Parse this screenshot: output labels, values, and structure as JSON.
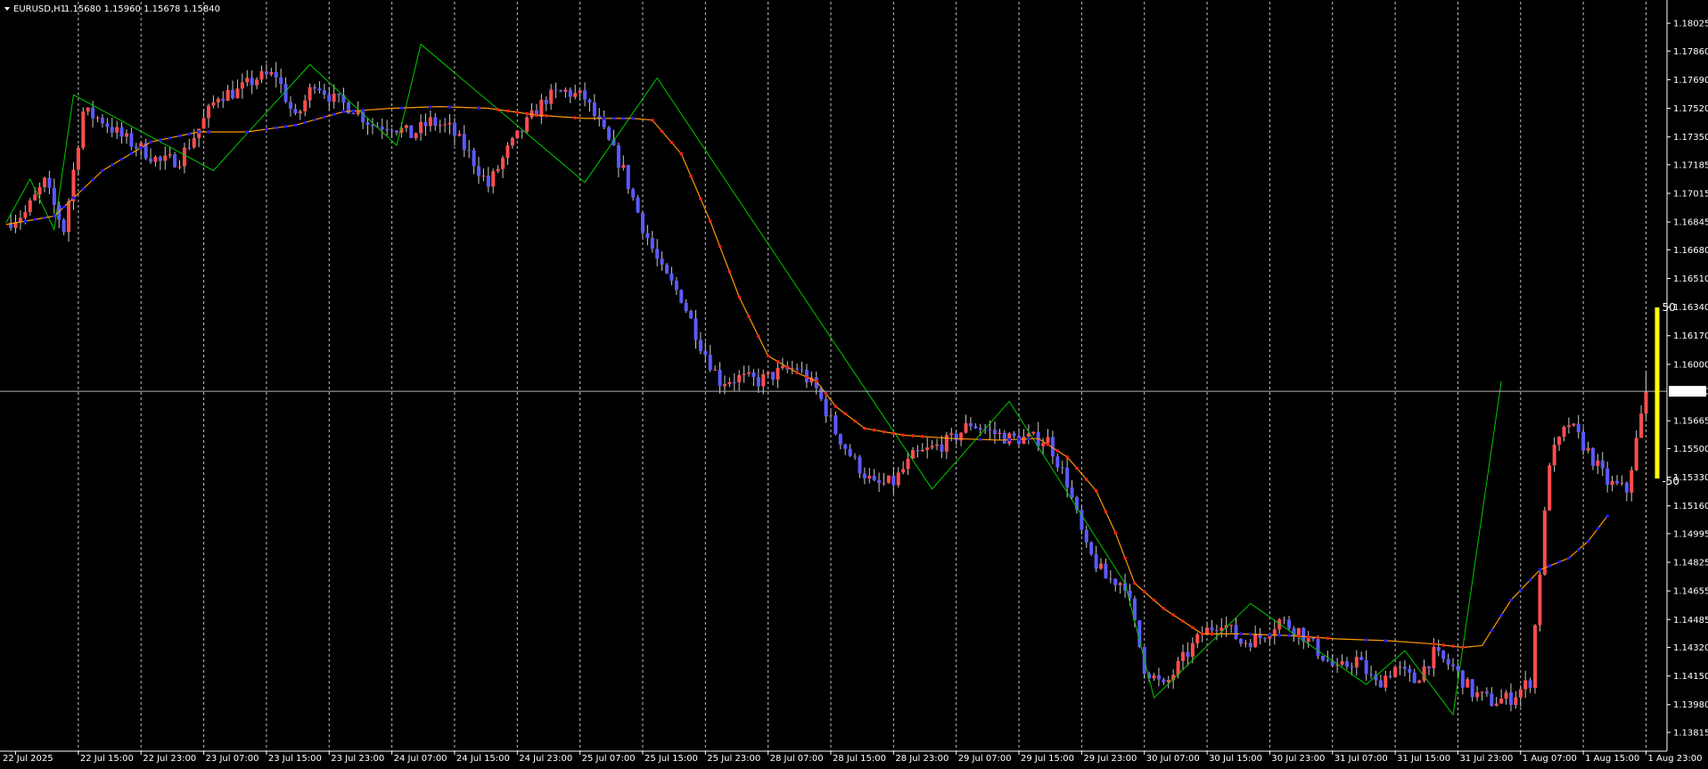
{
  "header": {
    "symbol": "EURUSD,H1",
    "ohlc": "1.15680 1.15960 1.15678 1.15840"
  },
  "current_price_label": "1.15840",
  "indicator": {
    "upper_label": "50",
    "lower_label": "-50",
    "color": "#ffff00"
  },
  "colors": {
    "background": "#000000",
    "bull_candle": "#ff4d4d",
    "bear_candle": "#5a5aff",
    "wick": "#c8c8c8",
    "zigzag": "#00c800",
    "moving_average": "#ff9900",
    "ma_dots_up": "#1e1eff",
    "ma_dots_down": "#ff1e1e",
    "grid": "#ffffff"
  },
  "chart_data": {
    "type": "candlestick",
    "ylim": [
      1.1373,
      1.1811
    ],
    "y_ticks": [
      "1.18025",
      "1.17860",
      "1.17690",
      "1.17520",
      "1.17350",
      "1.17185",
      "1.17015",
      "1.16845",
      "1.16680",
      "1.16510",
      "1.16340",
      "1.16170",
      "1.16000",
      "1.15840",
      "1.15665",
      "1.15500",
      "1.15330",
      "1.15160",
      "1.14995",
      "1.14825",
      "1.14655",
      "1.14485",
      "1.14320",
      "1.14150",
      "1.13980",
      "1.13815"
    ],
    "x_ticks": [
      "22 Jul 2025",
      "22 Jul 15:00",
      "22 Jul 23:00",
      "23 Jul 07:00",
      "23 Jul 15:00",
      "23 Jul 23:00",
      "24 Jul 07:00",
      "24 Jul 15:00",
      "24 Jul 23:00",
      "25 Jul 07:00",
      "25 Jul 15:00",
      "25 Jul 23:00",
      "28 Jul 07:00",
      "28 Jul 15:00",
      "28 Jul 23:00",
      "29 Jul 07:00",
      "29 Jul 15:00",
      "29 Jul 23:00",
      "30 Jul 07:00",
      "30 Jul 15:00",
      "30 Jul 23:00",
      "31 Jul 07:00",
      "31 Jul 15:00",
      "31 Jul 23:00",
      "1 Aug 07:00",
      "1 Aug 15:00",
      "1 Aug 23:00"
    ],
    "path": [
      [
        0,
        1.1684
      ],
      [
        4,
        1.169
      ],
      [
        8,
        1.1708
      ],
      [
        12,
        1.168
      ],
      [
        16,
        1.175
      ],
      [
        20,
        1.1745
      ],
      [
        24,
        1.1735
      ],
      [
        28,
        1.1728
      ],
      [
        32,
        1.172
      ],
      [
        36,
        1.1722
      ],
      [
        40,
        1.174
      ],
      [
        44,
        1.176
      ],
      [
        48,
        1.1762
      ],
      [
        52,
        1.177
      ],
      [
        56,
        1.1772
      ],
      [
        60,
        1.1745
      ],
      [
        64,
        1.1768
      ],
      [
        68,
        1.1757
      ],
      [
        72,
        1.1752
      ],
      [
        76,
        1.1742
      ],
      [
        80,
        1.1742
      ],
      [
        84,
        1.1736
      ],
      [
        88,
        1.1744
      ],
      [
        92,
        1.174
      ],
      [
        96,
        1.1725
      ],
      [
        100,
        1.1706
      ],
      [
        104,
        1.1727
      ],
      [
        108,
        1.1743
      ],
      [
        112,
        1.1758
      ],
      [
        116,
        1.1762
      ],
      [
        120,
        1.1758
      ],
      [
        124,
        1.1737
      ],
      [
        128,
        1.1715
      ],
      [
        132,
        1.1682
      ],
      [
        136,
        1.1655
      ],
      [
        140,
        1.164
      ],
      [
        144,
        1.1612
      ],
      [
        148,
        1.159
      ],
      [
        152,
        1.1592
      ],
      [
        156,
        1.159
      ],
      [
        160,
        1.1595
      ],
      [
        164,
        1.1598
      ],
      [
        168,
        1.1585
      ],
      [
        172,
        1.156
      ],
      [
        176,
        1.1542
      ],
      [
        180,
        1.1528
      ],
      [
        184,
        1.153
      ],
      [
        188,
        1.1545
      ],
      [
        192,
        1.155
      ],
      [
        196,
        1.1555
      ],
      [
        200,
        1.1565
      ],
      [
        204,
        1.156
      ],
      [
        208,
        1.1556
      ],
      [
        212,
        1.1556
      ],
      [
        216,
        1.1555
      ],
      [
        220,
        1.153
      ],
      [
        224,
        1.149
      ],
      [
        228,
        1.1473
      ],
      [
        232,
        1.147
      ],
      [
        236,
        1.142
      ],
      [
        240,
        1.1408
      ],
      [
        244,
        1.1425
      ],
      [
        248,
        1.144
      ],
      [
        252,
        1.1448
      ],
      [
        256,
        1.1435
      ],
      [
        260,
        1.1438
      ],
      [
        264,
        1.1448
      ],
      [
        268,
        1.1442
      ],
      [
        272,
        1.143
      ],
      [
        276,
        1.1418
      ],
      [
        280,
        1.1425
      ],
      [
        284,
        1.141
      ],
      [
        288,
        1.142
      ],
      [
        292,
        1.1412
      ],
      [
        296,
        1.1428
      ],
      [
        300,
        1.142
      ],
      [
        304,
        1.1405
      ],
      [
        308,
        1.14
      ],
      [
        312,
        1.1402
      ],
      [
        316,
        1.1412
      ],
      [
        320,
        1.1543
      ],
      [
        324,
        1.1565
      ],
      [
        328,
        1.1548
      ],
      [
        332,
        1.153
      ],
      [
        336,
        1.1525
      ],
      [
        340,
        1.1584
      ]
    ],
    "zigzag": [
      [
        0,
        1.1684
      ],
      [
        5,
        1.171
      ],
      [
        10,
        1.168
      ],
      [
        14,
        1.176
      ],
      [
        43,
        1.1715
      ],
      [
        63,
        1.1778
      ],
      [
        81,
        1.173
      ],
      [
        86,
        1.179
      ],
      [
        120,
        1.1708
      ],
      [
        135,
        1.177
      ],
      [
        192,
        1.1526
      ],
      [
        208,
        1.1578
      ],
      [
        232,
        1.147
      ],
      [
        238,
        1.1402
      ],
      [
        258,
        1.1458
      ],
      [
        282,
        1.141
      ],
      [
        290,
        1.143
      ],
      [
        300,
        1.1392
      ],
      [
        310,
        1.159
      ]
    ],
    "moving_average": [
      [
        0,
        1.1683
      ],
      [
        10,
        1.1688
      ],
      [
        20,
        1.1715
      ],
      [
        30,
        1.1732
      ],
      [
        40,
        1.1738
      ],
      [
        50,
        1.1738
      ],
      [
        60,
        1.1742
      ],
      [
        70,
        1.175
      ],
      [
        80,
        1.1752
      ],
      [
        90,
        1.1753
      ],
      [
        100,
        1.1752
      ],
      [
        110,
        1.1748
      ],
      [
        120,
        1.1746
      ],
      [
        130,
        1.1746
      ],
      [
        134,
        1.1745
      ],
      [
        140,
        1.1725
      ],
      [
        146,
        1.1685
      ],
      [
        152,
        1.164
      ],
      [
        158,
        1.1605
      ],
      [
        164,
        1.1595
      ],
      [
        168,
        1.159
      ],
      [
        172,
        1.1575
      ],
      [
        178,
        1.1562
      ],
      [
        186,
        1.1558
      ],
      [
        196,
        1.1556
      ],
      [
        206,
        1.1555
      ],
      [
        214,
        1.1556
      ],
      [
        220,
        1.1545
      ],
      [
        226,
        1.1525
      ],
      [
        230,
        1.15
      ],
      [
        234,
        1.147
      ],
      [
        240,
        1.1455
      ],
      [
        248,
        1.144
      ],
      [
        256,
        1.144
      ],
      [
        266,
        1.1439
      ],
      [
        276,
        1.1437
      ],
      [
        286,
        1.1436
      ],
      [
        296,
        1.1434
      ],
      [
        302,
        1.1432
      ],
      [
        306,
        1.1433
      ],
      [
        312,
        1.146
      ],
      [
        318,
        1.1478
      ],
      [
        324,
        1.1485
      ],
      [
        328,
        1.1495
      ],
      [
        332,
        1.151
      ]
    ]
  }
}
